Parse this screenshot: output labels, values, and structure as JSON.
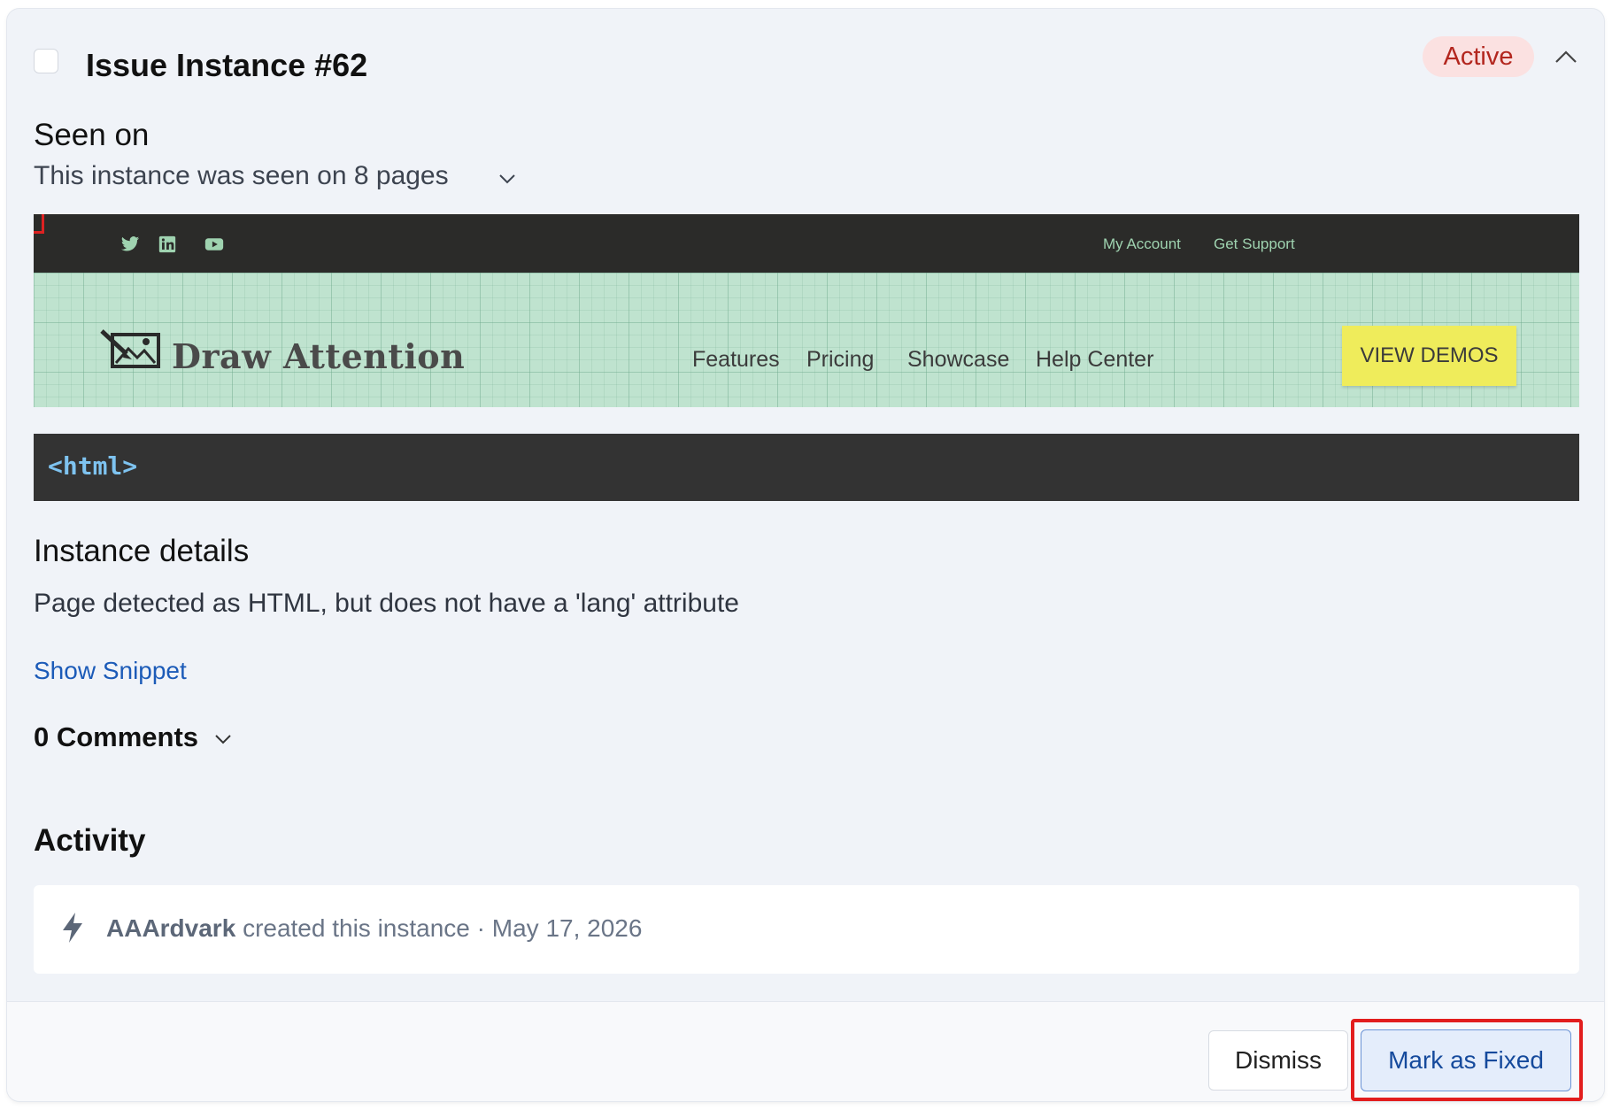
{
  "issue": {
    "title": "Issue Instance #62",
    "status": "Active",
    "colors": {
      "status_bg": "#fbe1e1",
      "status_text": "#b3261e"
    }
  },
  "seen_on": {
    "heading": "Seen on",
    "summary": "This instance was seen on 8 pages"
  },
  "preview": {
    "social_icons": [
      "twitter-icon",
      "linkedin-icon",
      "youtube-icon"
    ],
    "top_links": [
      "My Account",
      "Get Support"
    ],
    "logo_text": "Draw Attention",
    "nav_items": [
      "Features",
      "Pricing",
      "Showcase",
      "Help Center"
    ],
    "cta_label": "VIEW DEMOS"
  },
  "code": {
    "element": "<html>"
  },
  "details": {
    "heading": "Instance details",
    "description": "Page detected as HTML, but does not have a 'lang' attribute",
    "snippet_link": "Show Snippet"
  },
  "comments": {
    "label": "0 Comments"
  },
  "activity": {
    "heading": "Activity",
    "user": "AAArdvark",
    "action": "created this instance",
    "separator": "·",
    "date": "May 17, 2026"
  },
  "footer": {
    "dismiss_label": "Dismiss",
    "fixed_label": "Mark as Fixed"
  }
}
